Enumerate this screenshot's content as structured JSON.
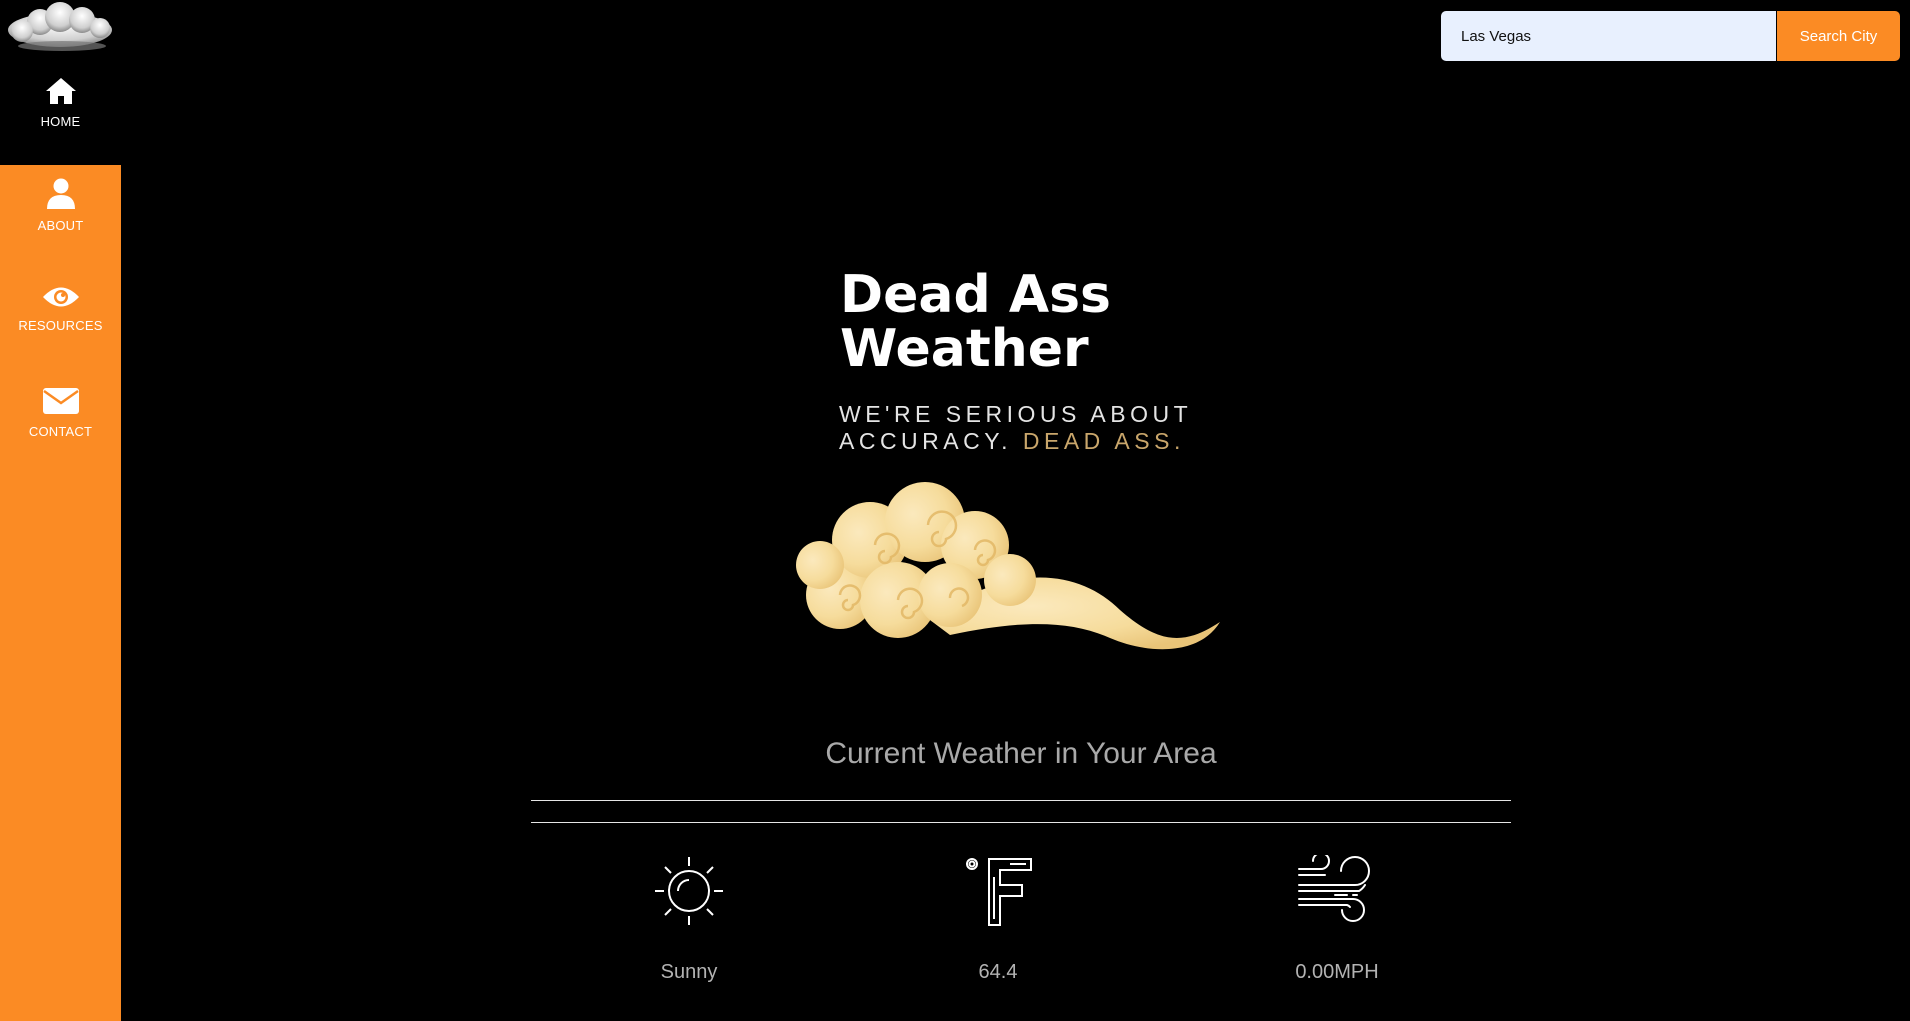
{
  "sidebar": {
    "items": [
      {
        "label": "HOME",
        "icon": "home-icon"
      },
      {
        "label": "ABOUT",
        "icon": "user-icon"
      },
      {
        "label": "RESOURCES",
        "icon": "eye-icon"
      },
      {
        "label": "CONTACT",
        "icon": "envelope-icon"
      }
    ]
  },
  "search": {
    "value": "Las Vegas",
    "button_label": "Search City"
  },
  "hero": {
    "title_line1": "Dead Ass",
    "title_line2": "Weather",
    "tagline_line1": "WE'RE SERIOUS ABOUT",
    "tagline_line2_start": "ACCURACY. ",
    "tagline_accent": "DEAD ASS",
    "tagline_end": "."
  },
  "weather": {
    "section_title": "Current Weather in Your Area",
    "condition": "Sunny",
    "temperature": "64.4",
    "wind": "0.00MPH"
  },
  "colors": {
    "accent": "#fb8b24",
    "background": "#000000",
    "tagline_accent": "#c9a66b",
    "cloud": "#f6dc9c"
  }
}
